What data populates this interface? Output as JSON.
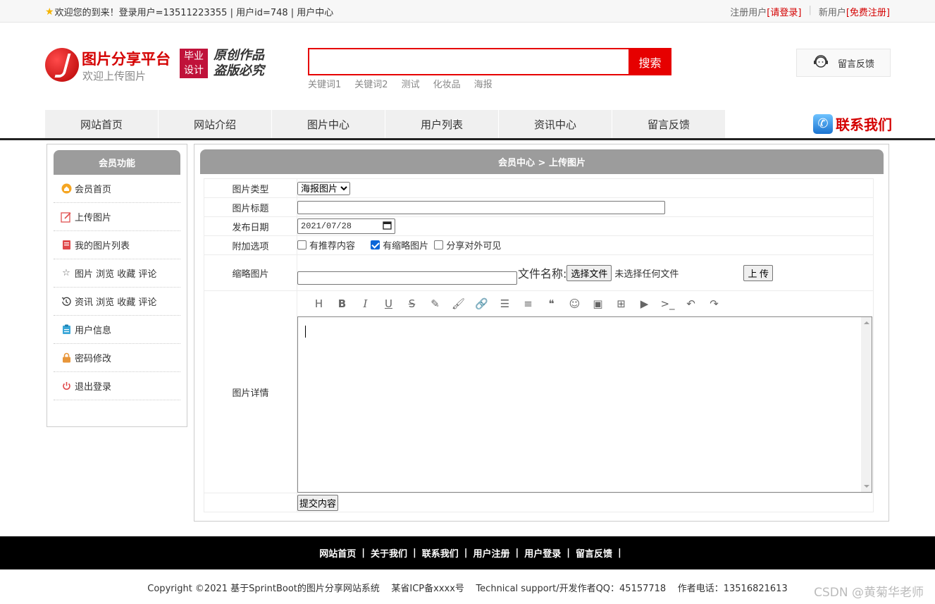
{
  "topbar": {
    "welcome": "欢迎您的到来！登录用户=13511223355 | 用户id=748 | 用户中心",
    "reg_label": "注册用户",
    "login_link": "[请登录]",
    "new_label": "新用户",
    "register_link": "[免费注册]"
  },
  "logo": {
    "name": "图片分享平台",
    "slogan": "欢迎上传图片",
    "badge_line1": "毕业",
    "badge_line2": "设计",
    "script_line1": "原创作品",
    "script_line2": "盗版必究"
  },
  "search": {
    "value": "",
    "button": "搜索",
    "keywords": [
      "关键词1",
      "关键词2",
      "测试",
      "化妆品",
      "海报"
    ]
  },
  "feedback": {
    "label": "留言反馈"
  },
  "nav": {
    "items": [
      "网站首页",
      "网站介绍",
      "图片中心",
      "用户列表",
      "资讯中心",
      "留言反馈"
    ],
    "contact": "联系我们"
  },
  "sidebar": {
    "title": "会员功能",
    "items": [
      {
        "label": "会员首页",
        "icon": "home-icon"
      },
      {
        "label": "上传图片",
        "icon": "edit-icon"
      },
      {
        "label": "我的图片列表",
        "icon": "list-icon"
      },
      {
        "label": "图片 浏览 收藏 评论",
        "icon": "star-icon"
      },
      {
        "label": "资讯 浏览 收藏 评论",
        "icon": "history-icon"
      },
      {
        "label": "用户信息",
        "icon": "clipboard-icon"
      },
      {
        "label": "密码修改",
        "icon": "lock-icon"
      },
      {
        "label": "退出登录",
        "icon": "power-icon"
      }
    ]
  },
  "main": {
    "title": "会员中心 > 上传图片",
    "form": {
      "type_label": "图片类型",
      "type_value": "海报图片",
      "title_label": "图片标题",
      "title_value": "",
      "date_label": "发布日期",
      "date_value": "2021/07/28",
      "options_label": "附加选项",
      "opt1": "有推荐内容",
      "opt2": "有缩略图片",
      "opt3": "分享对外可见",
      "thumb_label": "缩略图片",
      "file_name_label": "文件名称:",
      "choose_file": "选择文件",
      "no_file": "未选择任何文件",
      "upload": "上 传",
      "detail_label": "图片详情",
      "submit": "提交内容"
    }
  },
  "footer": {
    "links": [
      "网站首页",
      "关于我们",
      "联系我们",
      "用户注册",
      "用户登录",
      "留言反馈"
    ],
    "copyright": "Copyright ©2021 基于SprintBoot的图片分享网站系统    某省ICP备xxxx号    Technical support/开发作者QQ：45157718    作者电话：13516821613",
    "watermark": "CSDN @黄菊华老师"
  }
}
